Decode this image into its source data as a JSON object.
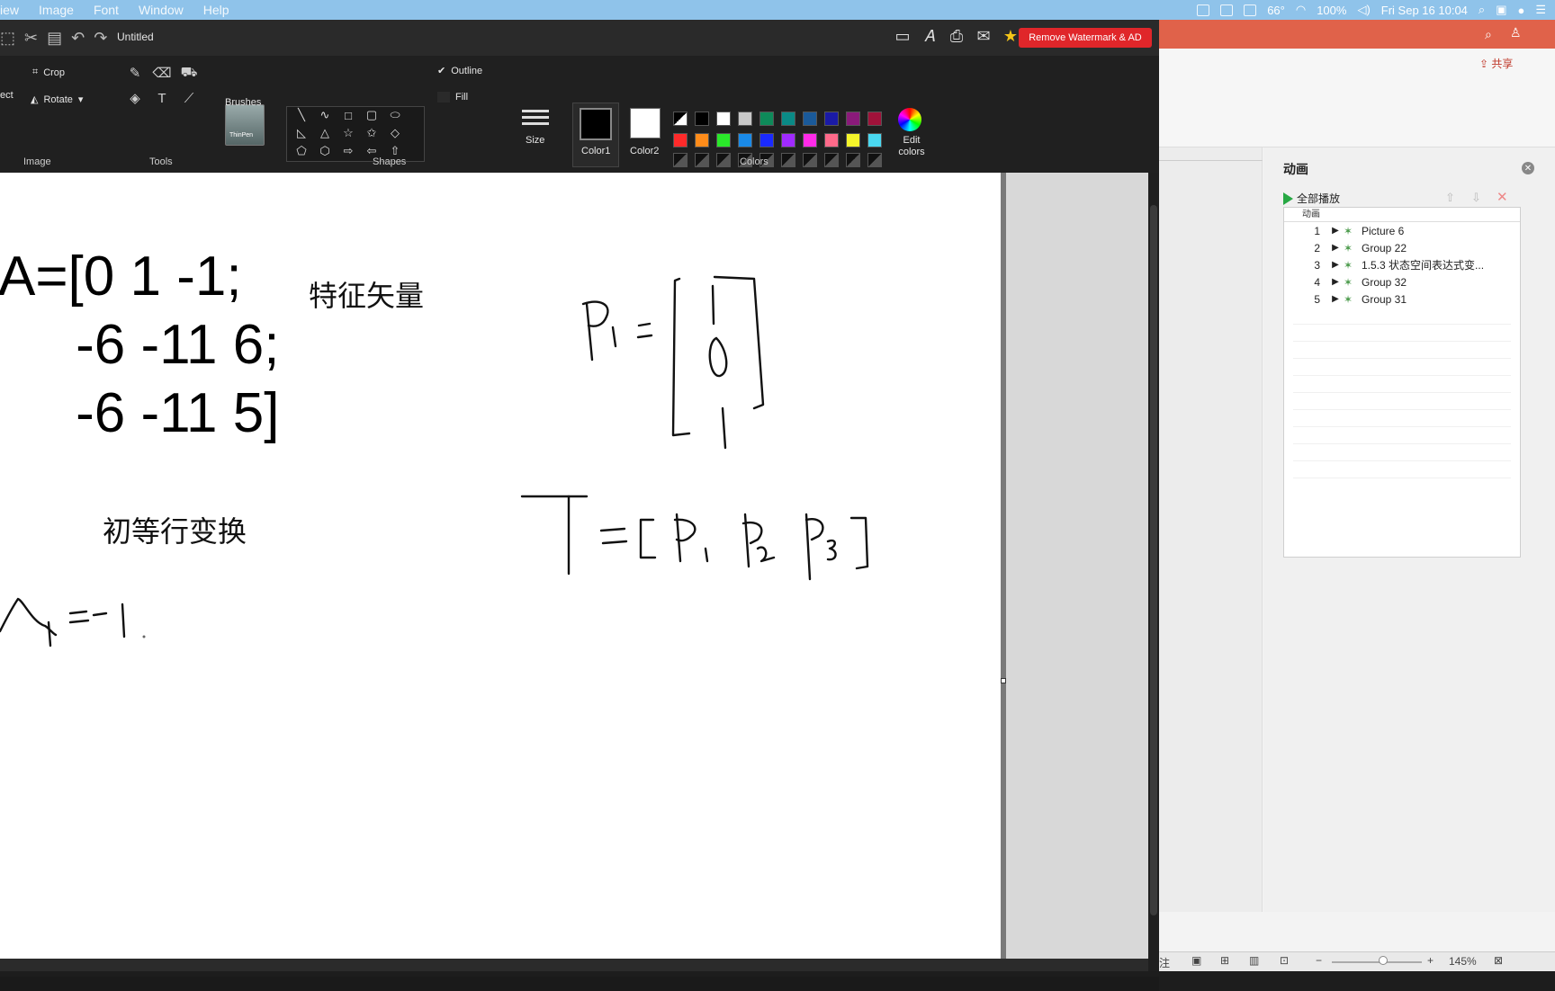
{
  "menubar": {
    "items": [
      "iew",
      "Image",
      "Font",
      "Window",
      "Help"
    ],
    "temperature": "66°",
    "battery": "100%",
    "datetime": "Fri Sep 16  10:04"
  },
  "paint": {
    "title": "Untitled",
    "remove_watermark": "Remove Watermark & AD",
    "ribbon": {
      "select_label": "ect",
      "crop_label": "Crop",
      "rotate_label": "Rotate",
      "image_group": "Image",
      "tools_group": "Tools",
      "brushes_label": "Brushes",
      "brushes_thumb_text": "ThinPen",
      "shapes_group": "Shapes",
      "outline_label": "Outline",
      "fill_label": "Fill",
      "size_label": "Size",
      "color1_label": "Color1",
      "color2_label": "Color2",
      "colors_group": "Colors",
      "edit_colors_label": "Edit colors"
    },
    "palette_row1": [
      "#000000",
      "#ffffff",
      "#c8c8c8",
      "#0e8a5a",
      "#0a8a86",
      "#1a5a9a",
      "#1a1aa6",
      "#8a1a7a",
      "#a0123a"
    ],
    "palette_row2": [
      "#ff2a2a",
      "#ff8c1a",
      "#2ae82a",
      "#1a8ae8",
      "#1a2aff",
      "#a02aff",
      "#ff2ae8",
      "#ff6a8a",
      "#f5f52a",
      "#4ad8f0"
    ]
  },
  "canvas": {
    "matrix_a": "A=[0 1 -1;\n     -6 -11 6;\n     -6 -11 5]",
    "eigenvector_label": "特征矢量",
    "row_ops_label": "初等行变换",
    "handwriting_p1": "P₁ = [1; 0; 1]",
    "handwriting_t": "T = [P₁ P₂ P₃]",
    "handwriting_lambda": "λ₁ = -1"
  },
  "ppt": {
    "share_label": "共享",
    "panel_title": "动画",
    "play_all": "全部播放",
    "list_header": "动画",
    "animations": [
      {
        "num": "1",
        "label": "Picture 6"
      },
      {
        "num": "2",
        "label": "Group 22"
      },
      {
        "num": "3",
        "label": "1.5.3  状态空间表达式变..."
      },
      {
        "num": "4",
        "label": "Group 32"
      },
      {
        "num": "5",
        "label": "Group 31"
      }
    ],
    "status_left": "注",
    "zoom": "145%"
  }
}
